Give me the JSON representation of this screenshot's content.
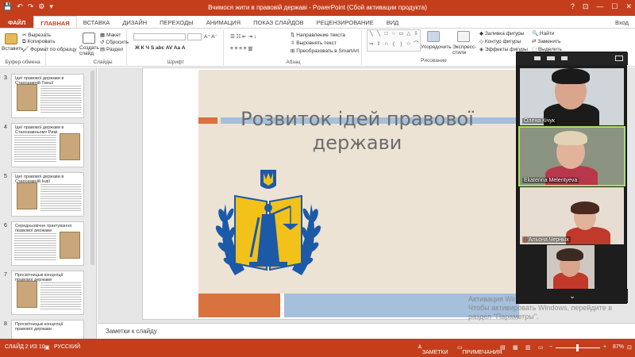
{
  "titlebar": {
    "title": "Вчимося жити в правовій державі - PowerPoint (Сбой активации продукта)",
    "qat": [
      "💾",
      "↶",
      "↷",
      "⚙",
      "▾"
    ],
    "controls": [
      "?",
      "⊡",
      "—",
      "☐",
      "✕"
    ]
  },
  "tabs": [
    "ФАЙЛ",
    "ГЛАВНАЯ",
    "ВСТАВКА",
    "ДИЗАЙН",
    "ПЕРЕХОДЫ",
    "АНИМАЦИЯ",
    "ПОКАЗ СЛАЙДОВ",
    "РЕЦЕНЗИРОВАНИЕ",
    "ВИД"
  ],
  "tabs_right": "Вход",
  "ribbon": {
    "clipboard": {
      "paste": "Вставить",
      "cut": "Вырезать",
      "copy": "Копировать",
      "format": "Формат по образцу",
      "label": "Буфер обмена"
    },
    "slides": {
      "new": "Создать слайд",
      "layout": "Макет",
      "reset": "Сбросить",
      "section": "Раздел",
      "label": "Слайды"
    },
    "font": {
      "label": "Шрифт",
      "buttons": "Ж К Ч S abc AV Aa A"
    },
    "paragraph": {
      "direction": "Направление текста",
      "align": "Выровнять текст",
      "smartart": "Преобразовать в SmartArt",
      "label": "Абзац"
    },
    "drawing": {
      "arrange": "Упорядочить",
      "styles": "Экспресс-стили",
      "fill": "Заливка фигуры",
      "outline": "Контур фигуры",
      "effects": "Эффекты фигуры",
      "label": "Рисование"
    },
    "editing": {
      "find": "Найти",
      "replace": "Заменить",
      "select": "Выделить"
    }
  },
  "thumbnails": [
    {
      "num": "3",
      "title": "Ідеї правової держави в Стародавній Греції"
    },
    {
      "num": "4",
      "title": "Ідеї правової держави в Стародавньому Римі"
    },
    {
      "num": "5",
      "title": "Ідеї правової держави в Стародавній Індії"
    },
    {
      "num": "6",
      "title": "Середньовічне трактування правової держави"
    },
    {
      "num": "7",
      "title": "Просвітницькі концепції правової держави"
    },
    {
      "num": "8",
      "title": "Просвітницькі концепції правової держави"
    }
  ],
  "slide": {
    "title": "Розвиток ідей правової держави"
  },
  "notes_placeholder": "Заметки к слайду",
  "status": {
    "slide": "СЛАЙД 2 ИЗ 10",
    "lang": "РУССКИЙ",
    "notes": "ЗАМЕТКИ",
    "comments": "ПРИМЕЧАНИЯ",
    "zoom": "87%"
  },
  "zoom_participants": [
    {
      "name": "Олена Кічук"
    },
    {
      "name": "Ekaterina Melentyeva"
    },
    {
      "name": "Альона Черных"
    },
    {
      "name": ""
    }
  ],
  "watermark": {
    "line1": "Активация Windows",
    "line2": "Чтобы активировать Windows, перейдите в раздел \"Параметры\"."
  },
  "colors": {
    "accent": "#c43e1c",
    "slide_orange": "#d8733e",
    "slide_blue": "#a6bfda",
    "slide_bg": "#ece3d5",
    "emblem_blue": "#1c5aa8",
    "emblem_yellow": "#f2c21b"
  }
}
